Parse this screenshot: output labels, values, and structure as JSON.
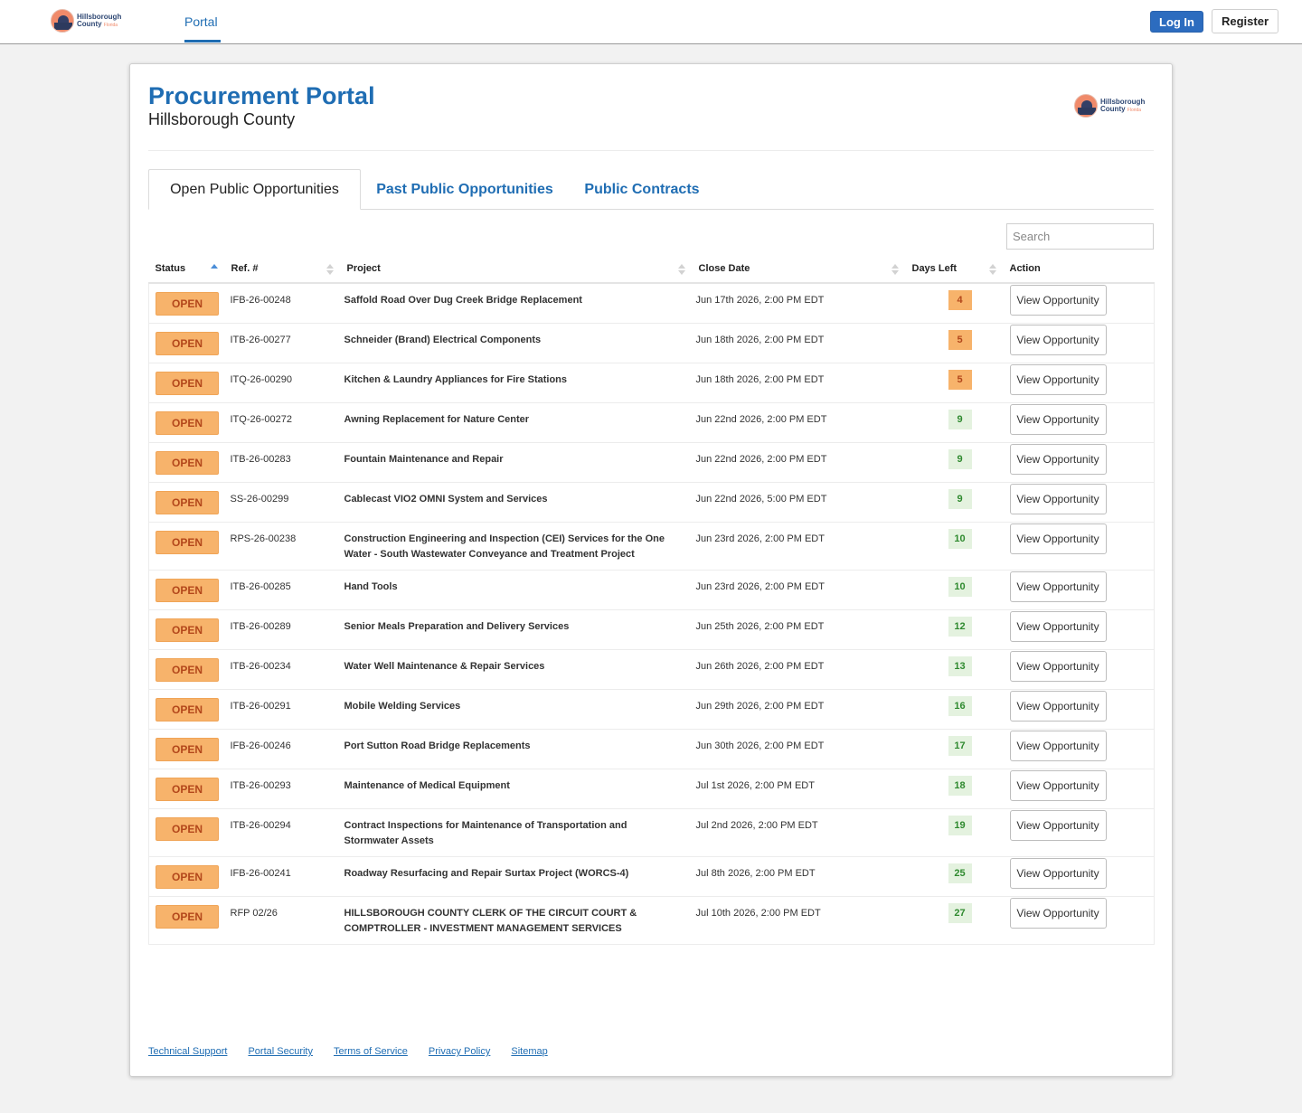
{
  "nav": {
    "logo_line1": "Hillsborough",
    "logo_line2": "County",
    "logo_tag": "Florida",
    "portal_label": "Portal",
    "login_label": "Log In",
    "register_label": "Register"
  },
  "header": {
    "title": "Procurement Portal",
    "subtitle": "Hillsborough County"
  },
  "tabs": [
    {
      "label": "Open Public Opportunities",
      "active": true
    },
    {
      "label": "Past Public Opportunities",
      "active": false
    },
    {
      "label": "Public Contracts",
      "active": false
    }
  ],
  "search": {
    "placeholder": "Search"
  },
  "table": {
    "columns": [
      "Status",
      "Ref. #",
      "Project",
      "Close Date",
      "Days Left",
      "Action"
    ],
    "sorted_column": "Status",
    "rows": [
      {
        "status": "OPEN",
        "ref": "IFB-26-00248",
        "project": "Saffold Road Over Dug Creek Bridge Replacement",
        "close": "Jun 17th 2026, 2:00 PM EDT",
        "days": "4",
        "urgent": true,
        "action": "View Opportunity"
      },
      {
        "status": "OPEN",
        "ref": "ITB-26-00277",
        "project": "Schneider (Brand) Electrical Components",
        "close": "Jun 18th 2026, 2:00 PM EDT",
        "days": "5",
        "urgent": true,
        "action": "View Opportunity"
      },
      {
        "status": "OPEN",
        "ref": "ITQ-26-00290",
        "project": "Kitchen & Laundry Appliances for Fire Stations",
        "close": "Jun 18th 2026, 2:00 PM EDT",
        "days": "5",
        "urgent": true,
        "action": "View Opportunity"
      },
      {
        "status": "OPEN",
        "ref": "ITQ-26-00272",
        "project": "Awning Replacement for Nature Center",
        "close": "Jun 22nd 2026, 2:00 PM EDT",
        "days": "9",
        "urgent": false,
        "action": "View Opportunity"
      },
      {
        "status": "OPEN",
        "ref": "ITB-26-00283",
        "project": "Fountain Maintenance and Repair",
        "close": "Jun 22nd 2026, 2:00 PM EDT",
        "days": "9",
        "urgent": false,
        "action": "View Opportunity"
      },
      {
        "status": "OPEN",
        "ref": "SS-26-00299",
        "project": "Cablecast VIO2 OMNI System and Services",
        "close": "Jun 22nd 2026, 5:00 PM EDT",
        "days": "9",
        "urgent": false,
        "action": "View Opportunity"
      },
      {
        "status": "OPEN",
        "ref": "RPS-26-00238",
        "project": "Construction Engineering and Inspection (CEI) Services for the One Water - South Wastewater Conveyance and Treatment Project",
        "close": "Jun 23rd 2026, 2:00 PM EDT",
        "days": "10",
        "urgent": false,
        "action": "View Opportunity"
      },
      {
        "status": "OPEN",
        "ref": "ITB-26-00285",
        "project": "Hand Tools",
        "close": "Jun 23rd 2026, 2:00 PM EDT",
        "days": "10",
        "urgent": false,
        "action": "View Opportunity"
      },
      {
        "status": "OPEN",
        "ref": "ITB-26-00289",
        "project": "Senior Meals Preparation and Delivery Services",
        "close": "Jun 25th 2026, 2:00 PM EDT",
        "days": "12",
        "urgent": false,
        "action": "View Opportunity"
      },
      {
        "status": "OPEN",
        "ref": "ITB-26-00234",
        "project": "Water Well Maintenance & Repair Services",
        "close": "Jun 26th 2026, 2:00 PM EDT",
        "days": "13",
        "urgent": false,
        "action": "View Opportunity"
      },
      {
        "status": "OPEN",
        "ref": "ITB-26-00291",
        "project": "Mobile Welding Services",
        "close": "Jun 29th 2026, 2:00 PM EDT",
        "days": "16",
        "urgent": false,
        "action": "View Opportunity"
      },
      {
        "status": "OPEN",
        "ref": "IFB-26-00246",
        "project": "Port Sutton Road Bridge Replacements",
        "close": "Jun 30th 2026, 2:00 PM EDT",
        "days": "17",
        "urgent": false,
        "action": "View Opportunity"
      },
      {
        "status": "OPEN",
        "ref": "ITB-26-00293",
        "project": "Maintenance of Medical Equipment",
        "close": "Jul 1st 2026, 2:00 PM EDT",
        "days": "18",
        "urgent": false,
        "action": "View Opportunity"
      },
      {
        "status": "OPEN",
        "ref": "ITB-26-00294",
        "project": "Contract Inspections for Maintenance of Transportation and Stormwater Assets",
        "close": "Jul 2nd 2026, 2:00 PM EDT",
        "days": "19",
        "urgent": false,
        "action": "View Opportunity"
      },
      {
        "status": "OPEN",
        "ref": "IFB-26-00241",
        "project": "Roadway Resurfacing and Repair Surtax Project (WORCS-4)",
        "close": "Jul 8th 2026, 2:00 PM EDT",
        "days": "25",
        "urgent": false,
        "action": "View Opportunity"
      },
      {
        "status": "OPEN",
        "ref": "RFP 02/26",
        "project": "HILLSBOROUGH COUNTY CLERK OF THE CIRCUIT COURT & COMPTROLLER - INVESTMENT MANAGEMENT SERVICES",
        "close": "Jul 10th 2026, 2:00 PM EDT",
        "days": "27",
        "urgent": false,
        "action": "View Opportunity"
      }
    ]
  },
  "footer": {
    "links": [
      "Technical Support",
      "Portal Security",
      "Terms of Service",
      "Privacy Policy",
      "Sitemap"
    ]
  },
  "colors": {
    "brand_blue": "#1f6db3",
    "open_badge": "#f7b36b",
    "days_ok_bg": "#e4f2df",
    "days_ok_text": "#2f8a2f"
  }
}
